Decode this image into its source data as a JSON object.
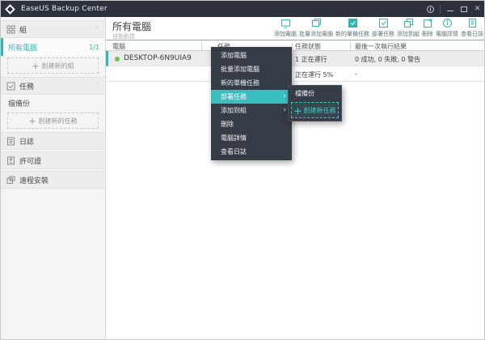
{
  "window": {
    "title": "EaseUS Backup Center"
  },
  "colors": {
    "accent_teal": "#2fb6b6",
    "titlebar_bg": "#2c313c",
    "menu_bg": "#363c46",
    "menu_highlight": "#3abfbf",
    "status_dot_green": "#7ac143",
    "sidebar_bg": "#f4f4f4",
    "selected_row_bg": "#ececec"
  },
  "sidebar": {
    "group_section": {
      "label": "組"
    },
    "all_computers": {
      "label": "所有電腦",
      "count": "1/1"
    },
    "create_group": {
      "label": "創建新的組"
    },
    "task_section": {
      "label": "任務"
    },
    "file_backup": {
      "label": "檔備份"
    },
    "create_task": {
      "label": "創建新的任務"
    },
    "logs": {
      "label": "日誌"
    },
    "license": {
      "label": "許可證"
    },
    "remote_install": {
      "label": "遠程安裝"
    }
  },
  "main": {
    "title": "所有電腦",
    "subtitle": "自動創建",
    "toolbar": [
      {
        "icon": "add-computer-icon",
        "label": "添加電腦"
      },
      {
        "icon": "batch-add-computer-icon",
        "label": "批量添加電腦"
      },
      {
        "icon": "new-single-task-icon",
        "label": "新的單機任務"
      },
      {
        "icon": "deploy-task-icon",
        "label": "部署任務"
      },
      {
        "icon": "add-to-group-icon",
        "label": "添加到組"
      },
      {
        "icon": "delete-icon",
        "label": "刪除"
      },
      {
        "icon": "computer-details-icon",
        "label": "電腦詳情"
      },
      {
        "icon": "view-logs-icon",
        "label": "查看日誌"
      }
    ],
    "table": {
      "columns": [
        "電腦",
        "任務",
        "任務狀態",
        "最後一次執行結果"
      ],
      "rows": [
        {
          "computer": "DESKTOP-6N9UIA9",
          "status": "1 正在運行",
          "result": "0 成功, 0 失敗, 0 警告"
        },
        {
          "computer": "",
          "status": "正在運行 5%",
          "result": "-"
        }
      ]
    }
  },
  "context_menu": {
    "items": [
      "添加電腦",
      "批量添加電腦",
      "新的單機任務",
      "部署任務",
      "添加到組",
      "刪除",
      "電腦詳情",
      "查看日誌"
    ],
    "highlighted": "部署任務",
    "submenu": {
      "items": [
        "檔備份"
      ],
      "create_label": "創建新任務"
    }
  }
}
